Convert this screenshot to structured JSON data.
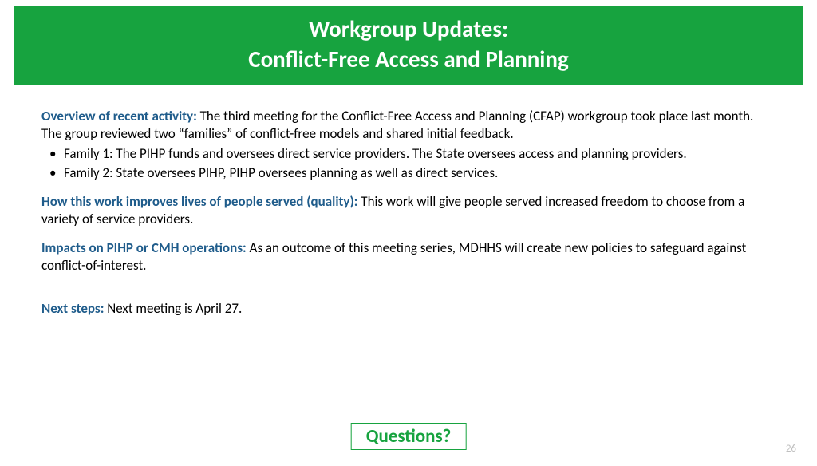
{
  "title": {
    "line1": "Workgroup Updates:",
    "line2": "Conflict-Free Access and Planning"
  },
  "sections": {
    "overview": {
      "label": "Overview of recent activity: ",
      "text": "The third meeting for the Conflict-Free Access and Planning (CFAP) workgroup took place last month. The group reviewed two “families” of conflict-free models and shared initial feedback.",
      "bullets": [
        "Family 1: The PIHP funds and oversees direct service providers. The State oversees access and planning providers.",
        "Family 2: State oversees PIHP, PIHP oversees planning as well as direct services."
      ]
    },
    "quality": {
      "label": "How this work improves lives of people served (quality): ",
      "text": "This work will give people served increased freedom to choose from a variety of service providers."
    },
    "impacts": {
      "label": "Impacts on PIHP or CMH operations: ",
      "text": "As an outcome of this meeting series, MDHHS will create new policies to safeguard against conflict-of-interest."
    },
    "nextsteps": {
      "label": "Next steps: ",
      "text": "Next meeting is April 27."
    }
  },
  "questions": "Questions?",
  "pageNumber": "26"
}
